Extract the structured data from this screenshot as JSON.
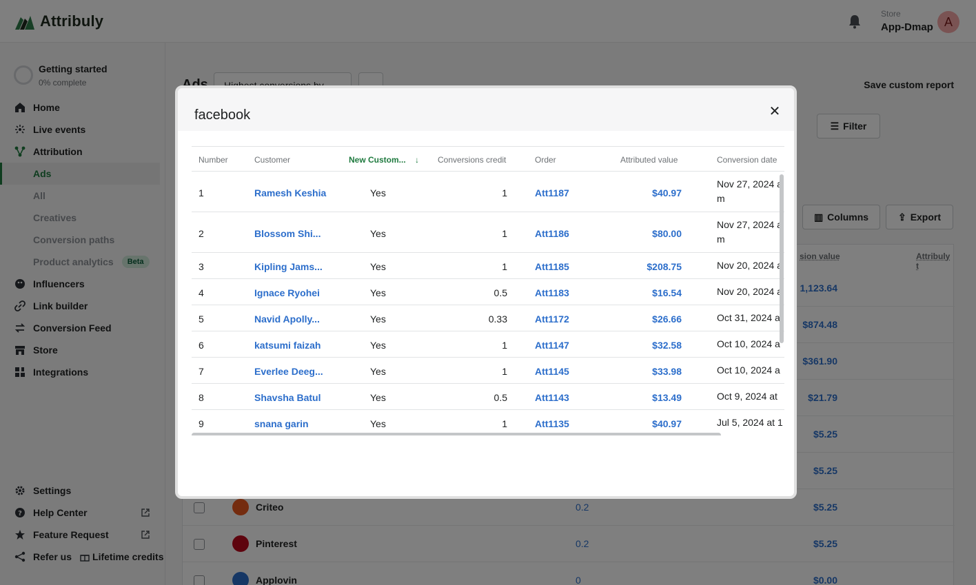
{
  "app": {
    "name": "Attribuly",
    "store_label": "Store",
    "store_name": "App-Dmap",
    "avatar_letter": "A"
  },
  "sidebar": {
    "getting_started": {
      "title": "Getting started",
      "progress": "0% complete"
    },
    "items": [
      {
        "label": "Home",
        "icon": "home-icon"
      },
      {
        "label": "Live events",
        "icon": "live-events-icon"
      },
      {
        "label": "Attribution",
        "icon": "attribution-icon"
      }
    ],
    "sub_items": [
      "Ads",
      "All",
      "Creatives",
      "Conversion paths",
      "Product analytics"
    ],
    "beta_label": "Beta",
    "items2": [
      {
        "label": "Influencers",
        "icon": "influencers-icon"
      },
      {
        "label": "Link builder",
        "icon": "link-icon"
      },
      {
        "label": "Conversion Feed",
        "icon": "conversion-feed-icon"
      },
      {
        "label": "Store",
        "icon": "store-icon"
      },
      {
        "label": "Integrations",
        "icon": "integrations-icon"
      }
    ],
    "bottom": {
      "settings": "Settings",
      "help": "Help Center",
      "feature": "Feature Request",
      "refer": "Refer us",
      "lifetime": "Lifetime credits"
    }
  },
  "main": {
    "title": "Ads",
    "report_select": "Highest conversions by",
    "save_report": "Save custom report",
    "filter": "Filter",
    "columns": "Columns",
    "export": "Export",
    "col_conv_value": "sion value",
    "col_attribuly": "Attribuly t",
    "rows": [
      {
        "name": "",
        "credit": "",
        "value": "1,123.64"
      },
      {
        "name": "",
        "credit": "",
        "value": "$874.48"
      },
      {
        "name": "",
        "credit": "",
        "value": "$361.90"
      },
      {
        "name": "",
        "credit": "",
        "value": "$21.79"
      },
      {
        "name": "",
        "credit": "",
        "value": "$5.25"
      },
      {
        "name": "",
        "credit": "",
        "value": "$5.25"
      },
      {
        "name": "Criteo",
        "credit": "0.2",
        "value": "$5.25"
      },
      {
        "name": "Pinterest",
        "credit": "0.2",
        "value": "$5.25"
      },
      {
        "name": "Applovin",
        "credit": "0",
        "value": "$0.00"
      }
    ]
  },
  "modal": {
    "title": "facebook",
    "columns": [
      "Number",
      "Customer",
      "New Custom...",
      "Conversions credit",
      "Order",
      "Attributed value",
      "Conversion date"
    ],
    "rows": [
      {
        "num": "1",
        "customer": "Ramesh Keshia",
        "new": "Yes",
        "credit": "1",
        "order": "Att1187",
        "value": "$40.97",
        "date": "Nov 27, 2024 a m"
      },
      {
        "num": "2",
        "customer": "Blossom Shi...",
        "new": "Yes",
        "credit": "1",
        "order": "Att1186",
        "value": "$80.00",
        "date": "Nov 27, 2024 a m"
      },
      {
        "num": "3",
        "customer": "Kipling Jams...",
        "new": "Yes",
        "credit": "1",
        "order": "Att1185",
        "value": "$208.75",
        "date": "Nov 20, 2024 a"
      },
      {
        "num": "4",
        "customer": "Ignace Ryohei",
        "new": "Yes",
        "credit": "0.5",
        "order": "Att1183",
        "value": "$16.54",
        "date": "Nov 20, 2024 a"
      },
      {
        "num": "5",
        "customer": "Navid Apolly...",
        "new": "Yes",
        "credit": "0.33",
        "order": "Att1172",
        "value": "$26.66",
        "date": "Oct 31, 2024 a"
      },
      {
        "num": "6",
        "customer": "katsumi faizah",
        "new": "Yes",
        "credit": "1",
        "order": "Att1147",
        "value": "$32.58",
        "date": "Oct 10, 2024 a"
      },
      {
        "num": "7",
        "customer": "Everlee Deeg...",
        "new": "Yes",
        "credit": "1",
        "order": "Att1145",
        "value": "$33.98",
        "date": "Oct 10, 2024 a"
      },
      {
        "num": "8",
        "customer": "Shavsha Batul",
        "new": "Yes",
        "credit": "0.5",
        "order": "Att1143",
        "value": "$13.49",
        "date": "Oct 9, 2024 at"
      },
      {
        "num": "9",
        "customer": "snana garin",
        "new": "Yes",
        "credit": "1",
        "order": "Att1135",
        "value": "$40.97",
        "date": "Jul 5, 2024 at 1"
      }
    ]
  }
}
